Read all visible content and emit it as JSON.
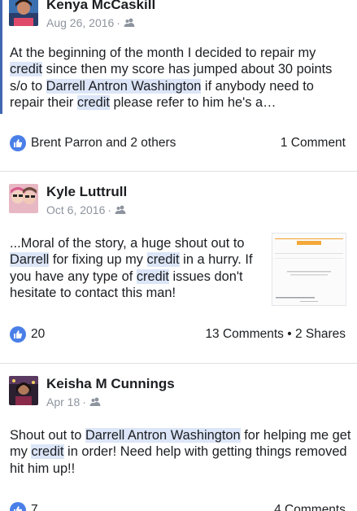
{
  "posts": [
    {
      "author": "Kenya McCaskill",
      "date": "Aug 26, 2016",
      "sep": "·",
      "privacy_icon": "friends-icon",
      "text": [
        {
          "t": "At the beginning of the month I decided to repair my "
        },
        {
          "t": "credit",
          "hl": true
        },
        {
          "t": " since then my score has jumped about 30 points s/o to "
        },
        {
          "t": "Darrell Antron Washington",
          "hl": true
        },
        {
          "t": " if anybody need to repair their "
        },
        {
          "t": "credit",
          "hl": true
        },
        {
          "t": " please refer to him he's a…"
        }
      ],
      "reactions": "Brent Parron and 2 others",
      "counts": "1 Comment"
    },
    {
      "author": "Kyle Luttrull",
      "date": "Oct 6, 2016",
      "sep": "·",
      "privacy_icon": "friends-icon",
      "text": [
        {
          "t": "...Moral of the story, a huge shout out to "
        },
        {
          "t": "Darrell",
          "hl": true
        },
        {
          "t": " for fixing up my "
        },
        {
          "t": "credit",
          "hl": true
        },
        {
          "t": " in a hurry. If you have any type of "
        },
        {
          "t": "credit",
          "hl": true
        },
        {
          "t": " issues don't hesitate to contact this man!"
        }
      ],
      "reactions": "20",
      "counts": "13 Comments • 2 Shares"
    },
    {
      "author": "Keisha M Cunnings",
      "date": "Apr 18",
      "sep": "·",
      "privacy_icon": "friends-icon",
      "text": [
        {
          "t": "Shout out to "
        },
        {
          "t": "Darrell Antron Washington",
          "hl": true
        },
        {
          "t": " for helping me get my "
        },
        {
          "t": "credit",
          "hl": true
        },
        {
          "t": " in order! Need help with getting things removed hit him up!!"
        }
      ],
      "reactions": "7",
      "counts": "4 Comments"
    }
  ],
  "colors": {
    "accent": "#4267b2",
    "like_badge": "#4a7fe8",
    "highlight": "#dce6f8",
    "meta_text": "#8d949e"
  },
  "icons": {
    "like": "thumbs-up-icon",
    "privacy": "friends-icon"
  }
}
